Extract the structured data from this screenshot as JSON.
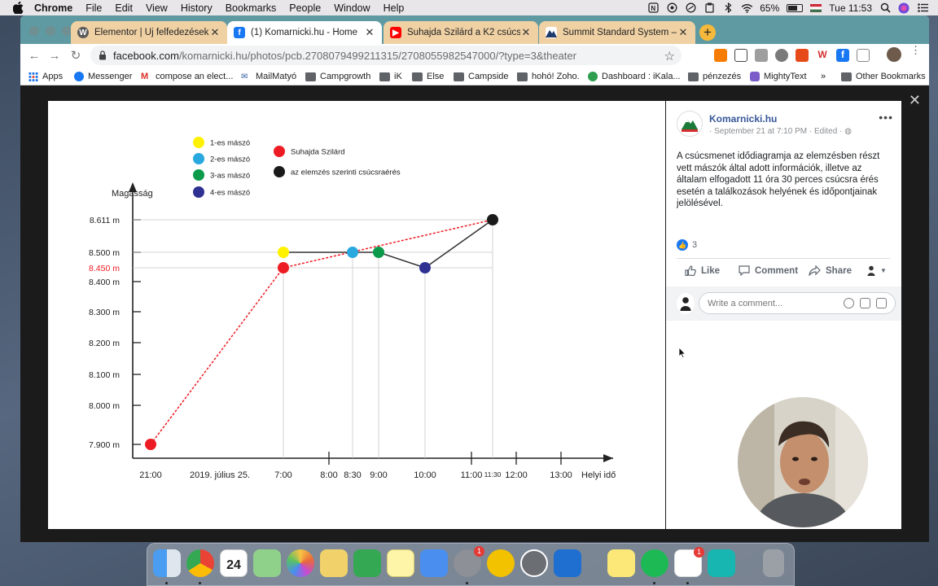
{
  "menubar": {
    "app_name": "Chrome",
    "menus": [
      "File",
      "Edit",
      "View",
      "History",
      "Bookmarks",
      "People",
      "Window",
      "Help"
    ],
    "battery": "65%",
    "clock": "Tue 11:53"
  },
  "tabs": [
    {
      "title": "Elementor | Új felfedezések – ú",
      "favicon": "wordpress-icon",
      "active": false
    },
    {
      "title": "(1) Komarnicki.hu - Home",
      "favicon": "facebook-icon",
      "active": true
    },
    {
      "title": "Suhajda Szilárd a K2 csúcsán -",
      "favicon": "youtube-icon",
      "active": false
    },
    {
      "title": "Summit Standard System – Sur",
      "favicon": "mountain-icon",
      "active": false
    }
  ],
  "address_bar": {
    "domain": "facebook.com",
    "path": "/komarnicki.hu/photos/pcb.2708079499211315/2708055982547000/?type=3&theater"
  },
  "bookmarks": [
    {
      "label": "Apps"
    },
    {
      "label": "Messenger"
    },
    {
      "label": "compose an elect..."
    },
    {
      "label": "MailMatyó"
    },
    {
      "label": "Campgrowth"
    },
    {
      "label": "iK"
    },
    {
      "label": "Else"
    },
    {
      "label": "Campside"
    },
    {
      "label": "hohó! Zoho."
    },
    {
      "label": "Dashboard : iKala..."
    },
    {
      "label": "pénzezés"
    },
    {
      "label": "MightyText"
    },
    {
      "label": "»"
    },
    {
      "label": "Other Bookmarks"
    }
  ],
  "post": {
    "page_name": "Komarnicki.hu",
    "meta": "· September 21 at 7:10 PM · Edited ·",
    "text": "A csúcsmenet idődiagramja az elemzésben részt vett mászók által adott információk, illetve az általam elfogadott 11 óra 30 perces csúcsra érés esetén a találkozások helyének és időpontjainak jelölésével.",
    "reactions_count": "3",
    "actions": {
      "like": "Like",
      "comment": "Comment",
      "share": "Share"
    },
    "comment_placeholder": "Write a comment..."
  },
  "chart_data": {
    "type": "line",
    "ylabel": "Magasság",
    "xlabel": "Helyi idő",
    "date_label": "2019. július 25.",
    "y_ticks": [
      "7.900 m",
      "8.000 m",
      "8.100 m",
      "8.200 m",
      "8.300 m",
      "8.400 m",
      "8.500 m",
      "8.611 m"
    ],
    "y_highlight_tick": "8.450 m",
    "x_ticks": [
      "21:00",
      "7:00",
      "8:00",
      "8:30",
      "9:00",
      "10:00",
      "11:00",
      "12:00",
      "13:00"
    ],
    "x_minor_tick": "11:30",
    "legend": [
      {
        "label": "1-es mászó",
        "color": "#fff200"
      },
      {
        "label": "2-es mászó",
        "color": "#29a8e0"
      },
      {
        "label": "3-as mászó",
        "color": "#0a9a4a"
      },
      {
        "label": "4-es mászó",
        "color": "#2e3192"
      },
      {
        "label": "Suhajda Szilárd",
        "color": "#ed1c24"
      },
      {
        "label": "az elemzés szerinti csúcsraérés",
        "color": "#1a1a1a"
      }
    ],
    "series": [
      {
        "name": "Suhajda Szilárd",
        "style": "dashed",
        "color": "#ed1c24",
        "points": [
          {
            "x": "21:00",
            "y": 7900
          },
          {
            "x": "7:00",
            "y": 8450
          },
          {
            "x": "11:30",
            "y": 8611
          }
        ]
      },
      {
        "name": "az elemzés szerinti csúcsraérés",
        "style": "solid",
        "color": "#333333",
        "points": [
          {
            "x": "7:00",
            "y": 8500
          },
          {
            "x": "8:30",
            "y": 8500
          },
          {
            "x": "9:00",
            "y": 8500
          },
          {
            "x": "10:00",
            "y": 8450
          },
          {
            "x": "11:30",
            "y": 8611
          }
        ]
      }
    ],
    "markers": [
      {
        "series": "1-es mászó",
        "x": "7:00",
        "y": 8500,
        "color": "#fff200"
      },
      {
        "series": "2-es mászó",
        "x": "8:30",
        "y": 8500,
        "color": "#29a8e0"
      },
      {
        "series": "3-as mászó",
        "x": "9:00",
        "y": 8500,
        "color": "#0a9a4a"
      },
      {
        "series": "4-es mászó",
        "x": "10:00",
        "y": 8450,
        "color": "#2e3192"
      },
      {
        "series": "Suhajda Szilárd",
        "x": "21:00",
        "y": 7900,
        "color": "#ed1c24"
      },
      {
        "series": "Suhajda Szilárd",
        "x": "7:00",
        "y": 8450,
        "color": "#ed1c24"
      },
      {
        "series": "az elemzés szerinti csúcsraérés",
        "x": "11:30",
        "y": 8611,
        "color": "#1a1a1a"
      }
    ],
    "y_range": [
      7900,
      8611
    ]
  }
}
